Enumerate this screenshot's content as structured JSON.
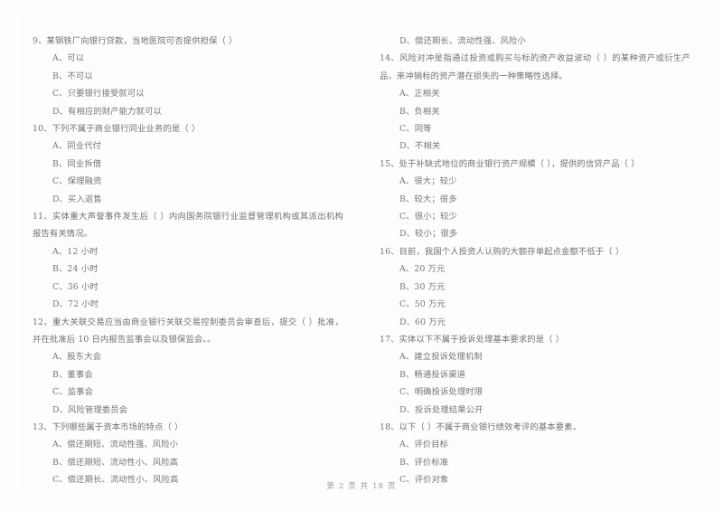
{
  "document": {
    "footer": "第 2 页 共 18 页"
  },
  "left_column": [
    {
      "stem": "9、某钢铁厂向银行贷款，当地医院可否提供担保（        ）",
      "options": [
        "A、可以",
        "B、不可以",
        "C、只要银行接受就可以",
        "D、有相应的财产能力就可以"
      ]
    },
    {
      "stem": "10、下列不属于商业银行同业业务的是（        ）",
      "options": [
        "A、同业代付",
        "B、同业拆借",
        "C、保理融资",
        "D、买入返售"
      ]
    },
    {
      "stem": "11、实体重大声誉事件发生后（        ）内向国务院银行业监督管理机构或其派出机构报告有关情况。",
      "options": [
        "A、12 小时",
        "B、24 小时",
        "C、36 小时",
        "D、72 小时"
      ]
    },
    {
      "stem": "12、重大关联交易应当由商业银行关联交易控制委员会审查后，提交（        ）批准，并在批准后 10 日内报告监事会以及银保监会。。",
      "options": [
        "A、股东大会",
        "B、董事会",
        "C、监事会",
        "D、风险管理委员会"
      ]
    },
    {
      "stem": "13、下列哪些属于资本市场的特点（        ）",
      "options": [
        "A、偿还期短、流动性强、风险小",
        "B、偿还期短、流动性小、风险高",
        "C、偿还期长、流动性小、风险高"
      ]
    }
  ],
  "right_column": [
    {
      "stem": "",
      "options": [
        "D、偿还期长、流动性强、风险小"
      ]
    },
    {
      "stem": "14、风险对冲是指通过投资或购买与标的资产收益波动（        ）的某种资产或衍生产品，来冲销标的资产潜在损失的一种策略性选择。",
      "options": [
        "A、正相关",
        "B、负相关",
        "C、同等",
        "D、不相关"
      ]
    },
    {
      "stem": "15、处于补缺式地位的商业银行资产规模（        ），提供的信贷产品（        ）",
      "options": [
        "A、很大；较少",
        "B、较大；很多",
        "C、很小；较少",
        "D、较小；很多"
      ]
    },
    {
      "stem": "16、目前，我国个人投资人认购的大额存单起点金额不低于（        ）",
      "options": [
        "A、20 万元",
        "B、30 万元",
        "C、50 万元",
        "D、60 万元"
      ]
    },
    {
      "stem": "17、实体以下不属于投诉处理基本要求的是（        ）",
      "options": [
        "A、建立投诉处理机制",
        "B、畅通投诉渠道",
        "C、明确投诉处理时限",
        "D、投诉处理结果公开"
      ]
    },
    {
      "stem": "18、以下（        ）不属于商业银行绩效考评的基本要素。",
      "options": [
        "A、评价目标",
        "B、评价标准",
        "C、评价对象"
      ]
    }
  ]
}
